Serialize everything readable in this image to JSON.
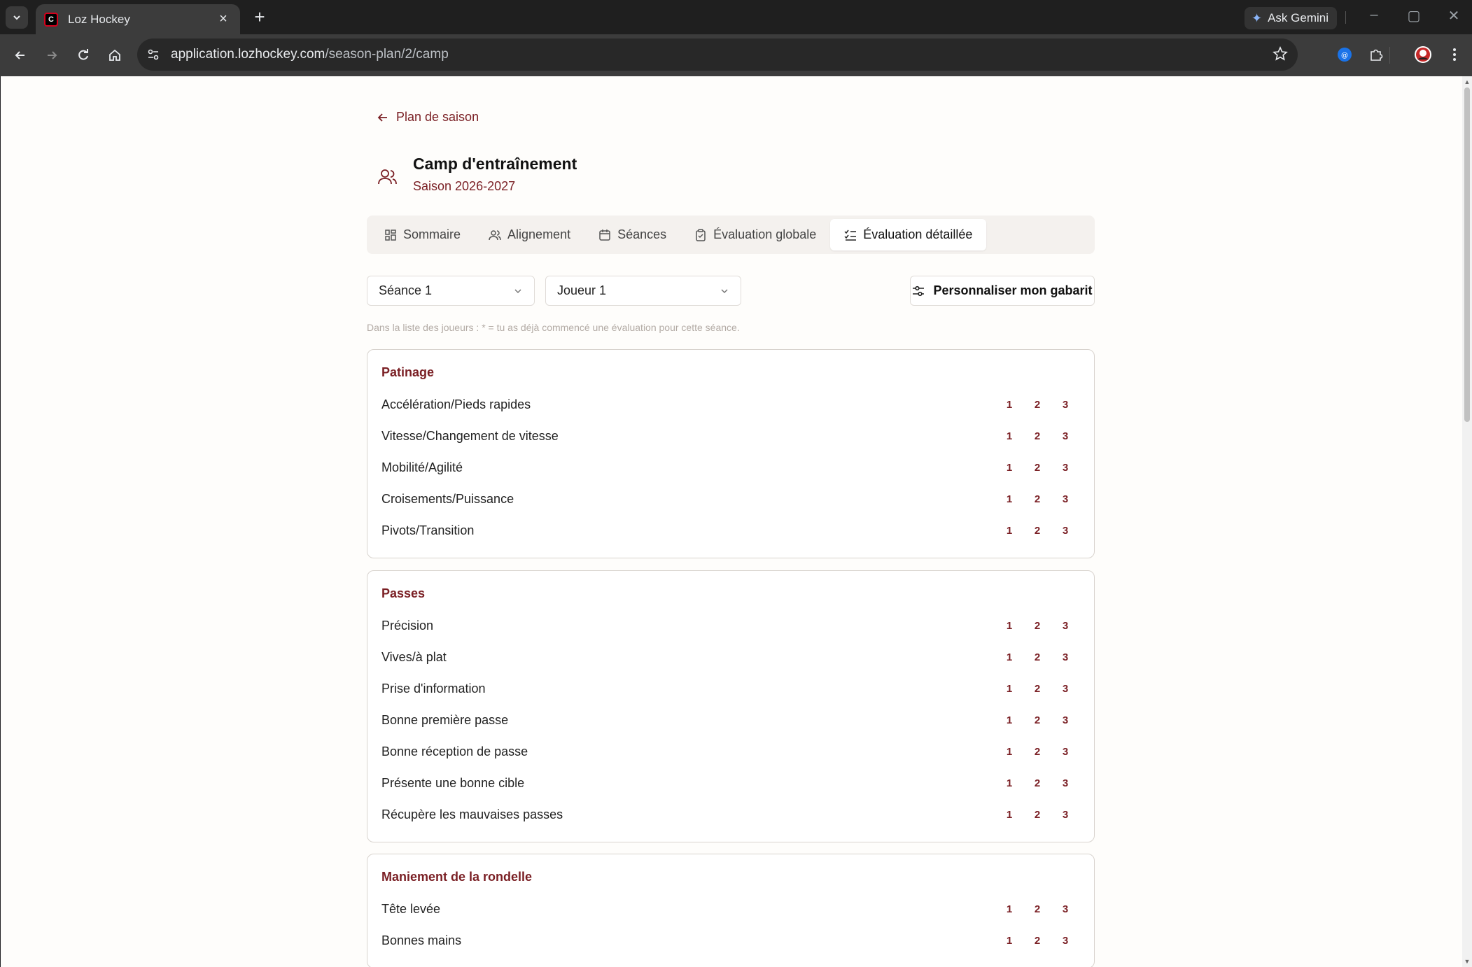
{
  "browser": {
    "tab_title": "Loz Hockey",
    "favicon_letter": "C",
    "gemini_label": "Ask Gemini",
    "url_host": "application.lozhockey.com",
    "url_path": "/season-plan/2/camp"
  },
  "page": {
    "back_label": "Plan de saison",
    "title": "Camp d'entraînement",
    "subtitle": "Saison 2026-2027",
    "tabs": [
      {
        "label": "Sommaire",
        "icon": "grid-icon"
      },
      {
        "label": "Alignement",
        "icon": "users-icon"
      },
      {
        "label": "Séances",
        "icon": "calendar-icon"
      },
      {
        "label": "Évaluation globale",
        "icon": "clipboard-check-icon"
      },
      {
        "label": "Évaluation détaillée",
        "icon": "list-check-icon",
        "active": true
      }
    ],
    "session_select": "Séance 1",
    "player_select": "Joueur 1",
    "customize_label": "Personnaliser mon gabarit",
    "hint": "Dans la liste des joueurs : * = tu as déjà commencé une évaluation pour cette séance."
  },
  "scale": [
    "1",
    "2",
    "3"
  ],
  "sections": [
    {
      "title": "Patinage",
      "criteria": [
        "Accélération/Pieds rapides",
        "Vitesse/Changement de vitesse",
        "Mobilité/Agilité",
        "Croisements/Puissance",
        "Pivots/Transition"
      ]
    },
    {
      "title": "Passes",
      "criteria": [
        "Précision",
        "Vives/à plat",
        "Prise d'information",
        "Bonne première passe",
        "Bonne réception de passe",
        "Présente une bonne cible",
        "Récupère les mauvaises passes"
      ]
    },
    {
      "title": "Maniement de la rondelle",
      "criteria": [
        "Tête levée",
        "Bonnes mains"
      ]
    }
  ],
  "colors": {
    "accent": "#7a1f24",
    "page_bg": "#fefdfb"
  }
}
